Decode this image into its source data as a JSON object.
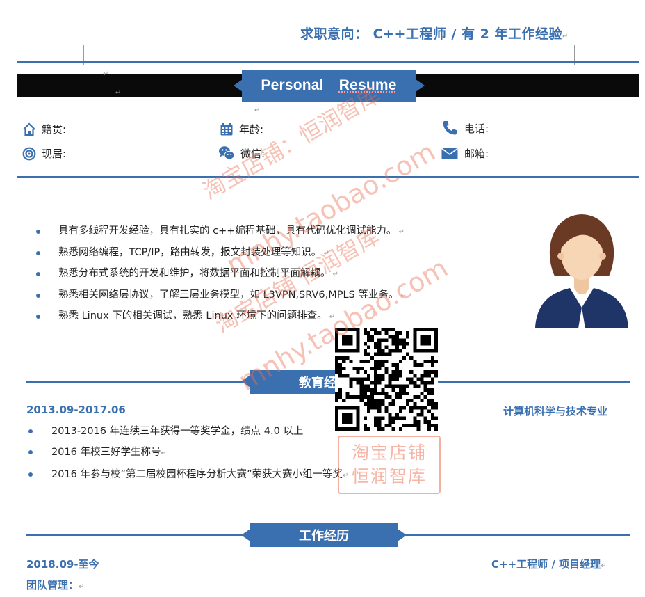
{
  "header": {
    "objective": "求职意向：  C++工程师 / 有 2 年工作经验"
  },
  "banner": {
    "title_word1": "Personal",
    "title_word2": "Resume"
  },
  "info": [
    {
      "icon": "home-icon",
      "label": "籍贯:"
    },
    {
      "icon": "calendar-icon",
      "label": "年龄:"
    },
    {
      "icon": "phone-icon",
      "label": "电话:"
    },
    {
      "icon": "target-icon",
      "label": "现居:"
    },
    {
      "icon": "wechat-icon",
      "label": "微信:"
    },
    {
      "icon": "mail-icon",
      "label": "邮箱:"
    }
  ],
  "skills": [
    "具有多线程开发经验，具有扎实的 c++编程基础，具有代码优化调试能力。",
    "熟悉网络编程，TCP/IP，路由转发，报文封装处理等知识。",
    "熟悉分布式系统的开发和维护，将数据平面和控制平面解耦。",
    "熟悉相关网络层协议，了解三层业务模型，如 L3VPN,SRV6,MPLS 等业务。",
    "熟悉 Linux 下的相关调试，熟悉 Linux 环境下的问题排查。"
  ],
  "education": {
    "section_title": "教育经历",
    "dates": "2013.09-2017.06",
    "major": "计算机科学与技术专业",
    "items": [
      "2013-2016 年连续三年获得一等奖学金，绩点 4.0 以上",
      "2016 年校三好学生称号",
      "2016 年参与校“第二届校园杯程序分析大赛”荣获大赛小组一等奖"
    ]
  },
  "work": {
    "section_title": "工作经历",
    "dates": "2018.09-至今",
    "role": "C++工程师 / 项目经理",
    "subheading": "团队管理："
  },
  "watermark": {
    "line1": "淘宝店铺：恒润智库",
    "line2": "mnhy.taobao.com",
    "line3": "淘宝店铺 恒润智库",
    "line4": "mnhy.taobao.com",
    "stamp_line1": "淘宝店铺",
    "stamp_line2": "恒润智库"
  },
  "colors": {
    "accent": "#3a6fb0",
    "band": "#0a0a0a",
    "watermark": "#eb6e50"
  }
}
